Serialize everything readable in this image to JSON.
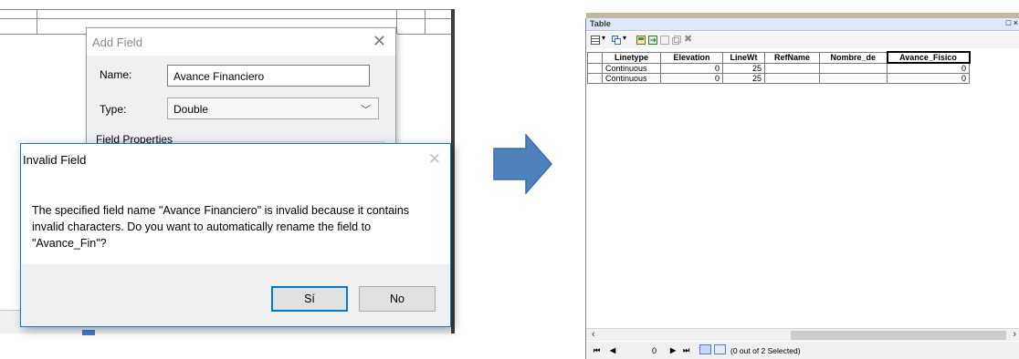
{
  "add_field_dialog": {
    "title": "Add Field",
    "name_label": "Name:",
    "name_value": "Avance Financiero",
    "type_label": "Type:",
    "type_value": "Double",
    "field_properties_label": "Field Properties"
  },
  "invalid_dialog": {
    "title": "Invalid Field",
    "message": "The specified field name \"Avance Financiero\" is invalid because it contains invalid characters. Do you want to automatically rename the field to \"Avance_Fin\"?",
    "yes_label": "Sí",
    "no_label": "No"
  },
  "table_window": {
    "title": "Table",
    "columns": [
      "Linetype",
      "Elevation",
      "LineWt",
      "RefName",
      "Nombre_de",
      "Avance_Fisico"
    ],
    "rows": [
      [
        "Continuous",
        "0",
        "25",
        "",
        "",
        "0"
      ],
      [
        "Continuous",
        "0",
        "25",
        "",
        "",
        "0"
      ]
    ],
    "record_number": "0",
    "status": "(0 out of 2 Selected)"
  },
  "colors": {
    "arrow_fill": "#4f81bd",
    "arrow_stroke": "#3a6ea8",
    "dialog_border": "#1979ca",
    "default_button_border": "#0078d7"
  },
  "icons": {
    "close": "close-icon",
    "chevron": "chevron-down-icon",
    "arrow": "right-arrow-icon"
  }
}
